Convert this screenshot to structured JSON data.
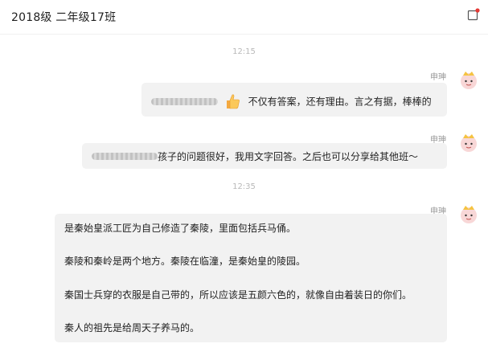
{
  "window": {
    "title": "2018级 二年级17班"
  },
  "messages": [
    {
      "time": "12:15"
    },
    {
      "sender": "申珅",
      "text": "不仅有答案，还有理由。言之有据，棒棒的",
      "emoji": "thumbs-up"
    },
    {
      "sender": "申珅",
      "text": "孩子的问题很好，我用文字回答。之后也可以分享给其他班～"
    },
    {
      "time": "12:35"
    },
    {
      "sender": "申珅",
      "paragraphs": [
        "是秦始皇派工匠为自己修造了秦陵，里面包括兵马俑。",
        "秦陵和秦岭是两个地方。秦陵在临潼，是秦始皇的陵园。",
        "秦国士兵穿的衣服是自己带的，所以应该是五颜六色的，就像自由着装日的你们。",
        "秦人的祖先是给周天子养马的。"
      ]
    }
  ],
  "colors": {
    "bubble": "#f2f2f2",
    "notify_dot": "#e53935"
  }
}
